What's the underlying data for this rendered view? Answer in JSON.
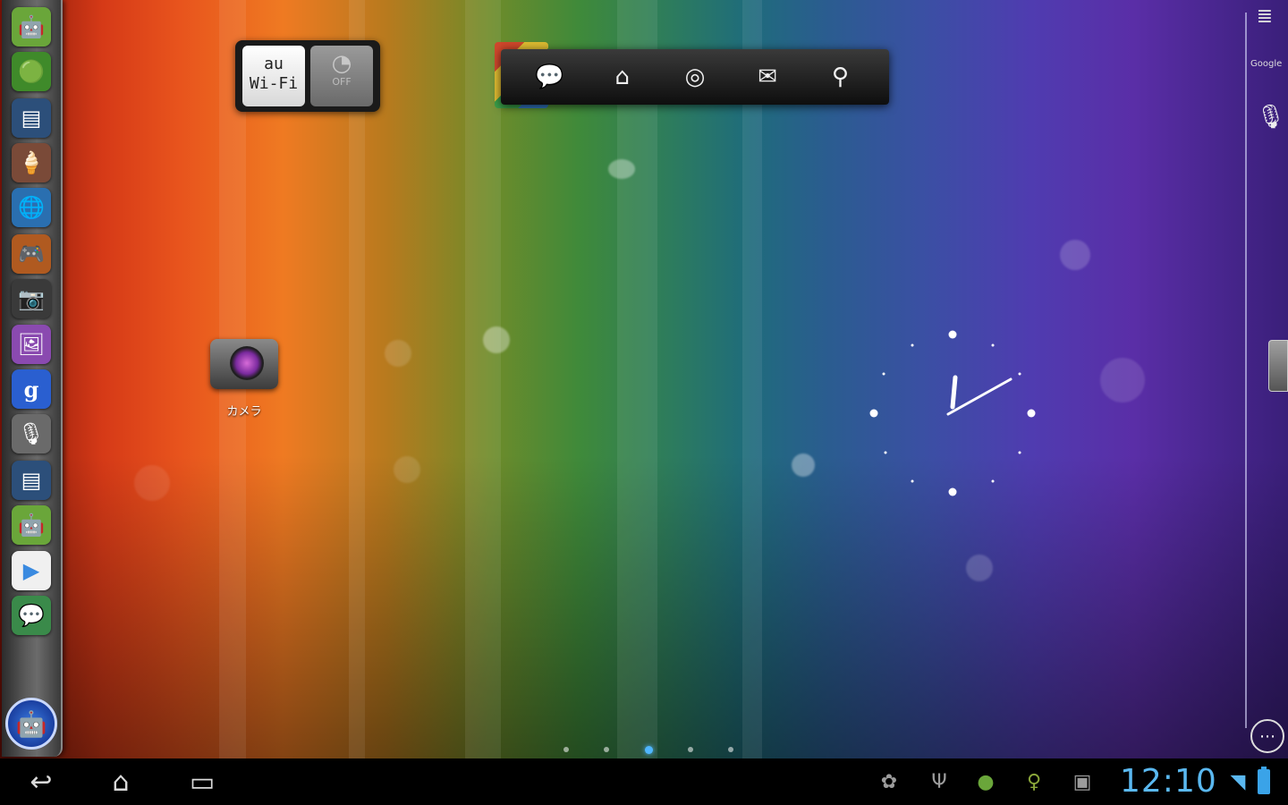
{
  "desktop": {
    "camera_label": "カメラ"
  },
  "wifi_widget": {
    "carrier_line1": "au",
    "carrier_line2": "Wi-Fi",
    "toggle_symbol": "◔",
    "toggle_text": "OFF"
  },
  "quick_bar": {
    "icons": [
      "message-icon",
      "home-icon",
      "settings-icon",
      "mail-icon",
      "search-icon"
    ],
    "glyphs": [
      "💬",
      "⌂",
      "◎",
      "✉",
      "⚲"
    ]
  },
  "left_dock": {
    "icons": [
      "android-icon",
      "android-market-icon",
      "screenshot-icon",
      "ice-cream-icon",
      "browser-globe-icon",
      "game-character-icon",
      "camera-icon",
      "gallery-icon",
      "google-search-icon",
      "microphone-icon",
      "screenshot-icon",
      "android-icon",
      "play-store-icon",
      "talk-icon"
    ],
    "glyphs": [
      "🤖",
      "🟢",
      "▤",
      "🍦",
      "🌐",
      "🎮",
      "📷",
      "🖼",
      "g",
      "🎙",
      "▤",
      "🤖",
      "▶",
      "💬"
    ],
    "home_glyph": "🤖"
  },
  "right_panel": {
    "menu_glyph": "≣",
    "google_text": "Google",
    "mic_glyph": "🎙",
    "apps_glyph": "⋯"
  },
  "page_indicator": {
    "count": 5,
    "active": 3
  },
  "system_bar": {
    "back_glyph": "↩",
    "home_glyph": "⌂",
    "recent_glyph": "▭",
    "status_icons": [
      "android-debug-icon",
      "usb-icon",
      "android-notification-icon",
      "light-icon",
      "briefcase-icon"
    ],
    "status_glyphs": [
      "✿",
      "Ψ",
      "●",
      "♀",
      "▣"
    ],
    "time": "12:10",
    "wifi_glyph": "◥"
  },
  "colors": {
    "clock_time": "#5ab8f0",
    "active_page_dot": "#4fb6ff"
  }
}
